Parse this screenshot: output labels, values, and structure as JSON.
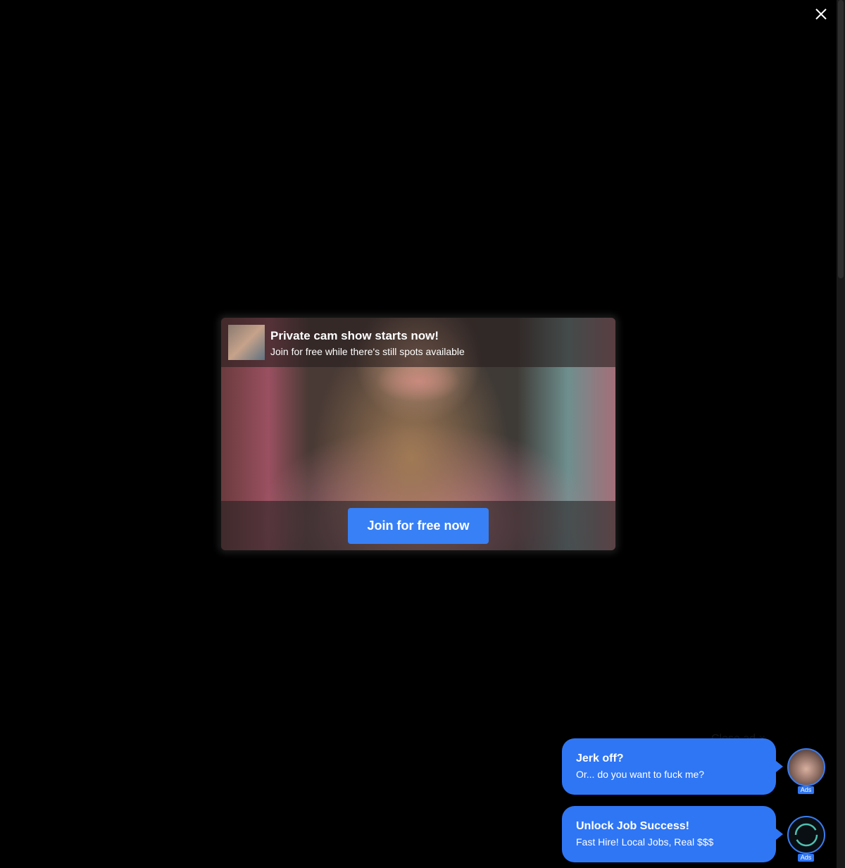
{
  "overlay": {
    "close_icon": "close-x-icon"
  },
  "modal": {
    "title": "Private cam show starts now!",
    "subtitle": "Join for free while there's still spots available",
    "cta_label": "Join for free now",
    "accent": "#3880f5"
  },
  "background_ad": {
    "close_label": "Close ad ×"
  },
  "chat_ads": [
    {
      "title": "Jerk off?",
      "subtitle": "Or... do you want to fuck me?",
      "badge": "Ads"
    },
    {
      "title": "Unlock Job Success!",
      "subtitle": "Fast Hire! Local Jobs, Real $$$",
      "badge": "Ads"
    }
  ]
}
